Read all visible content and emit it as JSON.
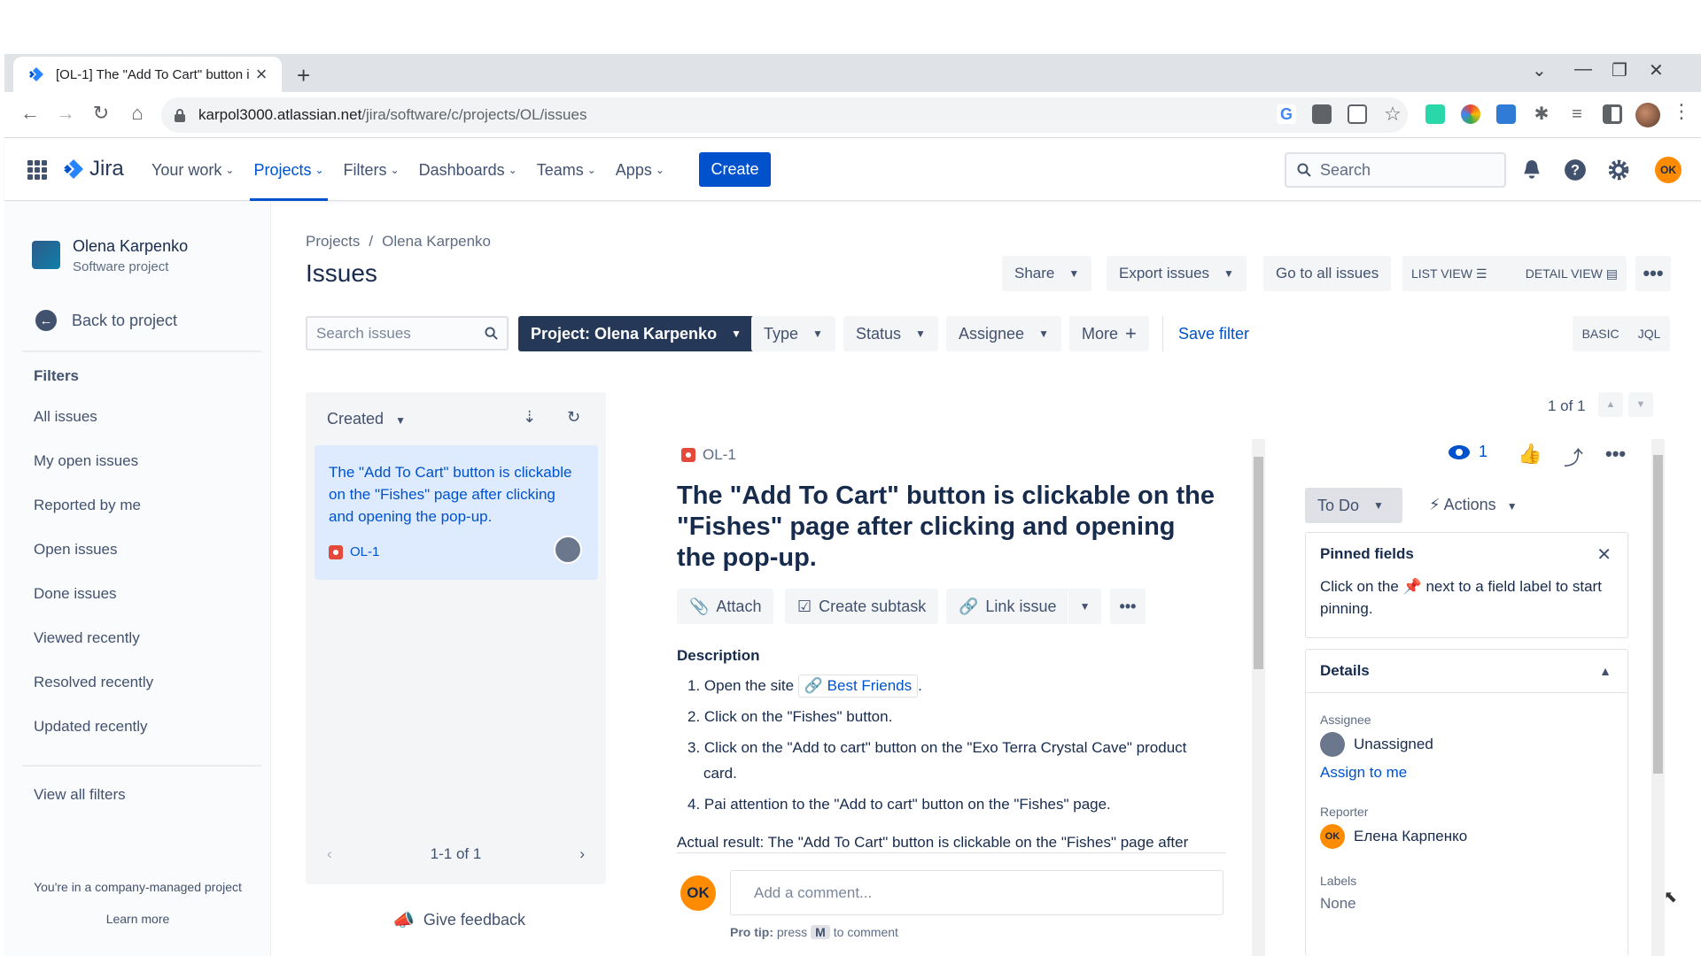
{
  "browser": {
    "tab_title": "[OL-1] The \"Add To Cart\" button i",
    "url_host": "karpol3000.atlassian.net",
    "url_path": "/jira/software/c/projects/OL/issues"
  },
  "nav": {
    "brand": "Jira",
    "menu": [
      "Your work",
      "Projects",
      "Filters",
      "Dashboards",
      "Teams",
      "Apps"
    ],
    "create": "Create",
    "search_placeholder": "Search",
    "user_initials": "OK"
  },
  "sidebar": {
    "project_name": "Olena Karpenko",
    "project_type": "Software project",
    "back": "Back to project",
    "section": "Filters",
    "filters": [
      "All issues",
      "My open issues",
      "Reported by me",
      "Open issues",
      "Done issues",
      "Viewed recently",
      "Resolved recently",
      "Updated recently"
    ],
    "view_all": "View all filters",
    "company_note": "You're in a company-managed project",
    "learn_more": "Learn more"
  },
  "header": {
    "crumb_root": "Projects",
    "crumb_project": "Olena Karpenko",
    "title": "Issues",
    "share": "Share",
    "export": "Export issues",
    "go_all": "Go to all issues",
    "list_view": "LIST VIEW",
    "detail_view": "DETAIL VIEW"
  },
  "filterbar": {
    "search_placeholder": "Search issues",
    "project": "Project: Olena Karpenko",
    "type": "Type",
    "status": "Status",
    "assignee": "Assignee",
    "more": "More",
    "save_filter": "Save filter",
    "basic": "BASIC",
    "jql": "JQL"
  },
  "list": {
    "sort": "Created",
    "card_title": "The \"Add To Cart\" button is clickable on the \"Fishes\" page after clicking and opening the pop-up.",
    "card_key": "OL-1",
    "pager": "1-1 of 1",
    "feedback": "Give feedback"
  },
  "issue": {
    "counter": "1 of 1",
    "key": "OL-1",
    "title": "The \"Add To Cart\" button is clickable on the \"Fishes\" page after clicking and opening the pop-up.",
    "attach": "Attach",
    "subtask": "Create subtask",
    "link": "Link issue",
    "desc_heading": "Description",
    "step1_pre": "1. Open the site",
    "step1_link": "Best Friends",
    "step1_post": ".",
    "step2": "2. Click on the \"Fishes\" button.",
    "step3": "3. Click on the \"Add to cart\" button on the \"Exo Terra Crystal Cave\" product card.",
    "step4": "4. Pai attention to the \"Add to cart\" button on the \"Fishes\" page.",
    "actual": "Actual result: The \"Add To Cart\" button is clickable on the \"Fishes\" page after",
    "comment_avatar": "OK",
    "comment_placeholder": "Add a comment...",
    "protip_a": "Pro tip:",
    "protip_b": "press",
    "protip_key": "M",
    "protip_c": "to comment"
  },
  "right": {
    "watchers": "1",
    "status": "To Do",
    "actions": "Actions",
    "pinned_heading": "Pinned fields",
    "pinned_text_a": "Click on the",
    "pinned_text_b": "next to a field label to start pinning.",
    "details_heading": "Details",
    "assignee_label": "Assignee",
    "assignee_value": "Unassigned",
    "assign_me": "Assign to me",
    "reporter_label": "Reporter",
    "reporter_initials": "OK",
    "reporter_value": "Елена Карпенко",
    "labels_label": "Labels",
    "labels_value": "None"
  },
  "colors": {
    "brand_blue": "#0052cc",
    "bug_red": "#e5493a",
    "avatar_orange": "#ff8b00",
    "selected_card": "#deebff"
  }
}
